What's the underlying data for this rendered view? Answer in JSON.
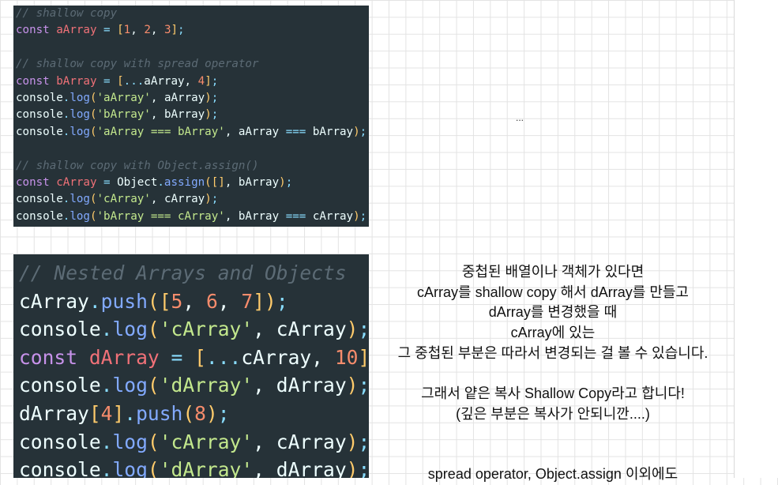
{
  "code_block_1": {
    "lines": [
      [
        [
          "c-comment",
          "// shallow copy"
        ]
      ],
      [
        [
          "c-kw",
          "const "
        ],
        [
          "c-var",
          "aArray"
        ],
        [
          "c-op",
          " = "
        ],
        [
          "c-br",
          "["
        ],
        [
          "c-num",
          "1"
        ],
        [
          "c-plain",
          ", "
        ],
        [
          "c-num",
          "2"
        ],
        [
          "c-plain",
          ", "
        ],
        [
          "c-num",
          "3"
        ],
        [
          "c-br",
          "]"
        ],
        [
          "c-op",
          ";"
        ]
      ],
      [],
      [
        [
          "c-comment",
          "// shallow copy with spread operator"
        ]
      ],
      [
        [
          "c-kw",
          "const "
        ],
        [
          "c-var",
          "bArray"
        ],
        [
          "c-op",
          " = "
        ],
        [
          "c-br",
          "["
        ],
        [
          "c-op",
          "..."
        ],
        [
          "c-plain",
          "aArray, "
        ],
        [
          "c-num",
          "4"
        ],
        [
          "c-br",
          "]"
        ],
        [
          "c-op",
          ";"
        ]
      ],
      [
        [
          "c-plain",
          "console"
        ],
        [
          "c-op",
          "."
        ],
        [
          "c-fn",
          "log"
        ],
        [
          "c-br",
          "("
        ],
        [
          "c-str",
          "'aArray'"
        ],
        [
          "c-plain",
          ", aArray"
        ],
        [
          "c-br",
          ")"
        ],
        [
          "c-op",
          ";"
        ]
      ],
      [
        [
          "c-plain",
          "console"
        ],
        [
          "c-op",
          "."
        ],
        [
          "c-fn",
          "log"
        ],
        [
          "c-br",
          "("
        ],
        [
          "c-str",
          "'bArray'"
        ],
        [
          "c-plain",
          ", bArray"
        ],
        [
          "c-br",
          ")"
        ],
        [
          "c-op",
          ";"
        ]
      ],
      [
        [
          "c-plain",
          "console"
        ],
        [
          "c-op",
          "."
        ],
        [
          "c-fn",
          "log"
        ],
        [
          "c-br",
          "("
        ],
        [
          "c-str",
          "'aArray === bArray'"
        ],
        [
          "c-plain",
          ", aArray "
        ],
        [
          "c-op",
          "==="
        ],
        [
          "c-plain",
          " bArray"
        ],
        [
          "c-br",
          ")"
        ],
        [
          "c-op",
          ";"
        ]
      ],
      [],
      [
        [
          "c-comment",
          "// shallow copy with Object.assign()"
        ]
      ],
      [
        [
          "c-kw",
          "const "
        ],
        [
          "c-var",
          "cArray"
        ],
        [
          "c-op",
          " = "
        ],
        [
          "c-plain",
          "Object"
        ],
        [
          "c-op",
          "."
        ],
        [
          "c-fn",
          "assign"
        ],
        [
          "c-br",
          "("
        ],
        [
          "c-br",
          "[]"
        ],
        [
          "c-plain",
          ", bArray"
        ],
        [
          "c-br",
          ")"
        ],
        [
          "c-op",
          ";"
        ]
      ],
      [
        [
          "c-plain",
          "console"
        ],
        [
          "c-op",
          "."
        ],
        [
          "c-fn",
          "log"
        ],
        [
          "c-br",
          "("
        ],
        [
          "c-str",
          "'cArray'"
        ],
        [
          "c-plain",
          ", cArray"
        ],
        [
          "c-br",
          ")"
        ],
        [
          "c-op",
          ";"
        ]
      ],
      [
        [
          "c-plain",
          "console"
        ],
        [
          "c-op",
          "."
        ],
        [
          "c-fn",
          "log"
        ],
        [
          "c-br",
          "("
        ],
        [
          "c-str",
          "'bArray === cArray'"
        ],
        [
          "c-plain",
          ", bArray "
        ],
        [
          "c-op",
          "==="
        ],
        [
          "c-plain",
          " cArray"
        ],
        [
          "c-br",
          ")"
        ],
        [
          "c-op",
          ";"
        ]
      ]
    ]
  },
  "code_block_2": {
    "lines": [
      [
        [
          "c-comment",
          "// Nested Arrays and Objects"
        ]
      ],
      [
        [
          "c-plain",
          "cArray"
        ],
        [
          "c-op",
          "."
        ],
        [
          "c-fn",
          "push"
        ],
        [
          "c-br",
          "("
        ],
        [
          "c-br",
          "["
        ],
        [
          "c-num",
          "5"
        ],
        [
          "c-plain",
          ", "
        ],
        [
          "c-num",
          "6"
        ],
        [
          "c-plain",
          ", "
        ],
        [
          "c-num",
          "7"
        ],
        [
          "c-br",
          "]"
        ],
        [
          "c-br",
          ")"
        ],
        [
          "c-op",
          ";"
        ]
      ],
      [
        [
          "c-plain",
          "console"
        ],
        [
          "c-op",
          "."
        ],
        [
          "c-fn",
          "log"
        ],
        [
          "c-br",
          "("
        ],
        [
          "c-str",
          "'cArray'"
        ],
        [
          "c-plain",
          ", cArray"
        ],
        [
          "c-br",
          ")"
        ],
        [
          "c-op",
          ";"
        ]
      ],
      [
        [
          "c-kw",
          "const "
        ],
        [
          "c-var",
          "dArray"
        ],
        [
          "c-op",
          " = "
        ],
        [
          "c-br",
          "["
        ],
        [
          "c-op",
          "..."
        ],
        [
          "c-plain",
          "cArray, "
        ],
        [
          "c-num",
          "10"
        ],
        [
          "c-br",
          "]"
        ],
        [
          "c-op",
          ";"
        ]
      ],
      [
        [
          "c-plain",
          "console"
        ],
        [
          "c-op",
          "."
        ],
        [
          "c-fn",
          "log"
        ],
        [
          "c-br",
          "("
        ],
        [
          "c-str",
          "'dArray'"
        ],
        [
          "c-plain",
          ", dArray"
        ],
        [
          "c-br",
          ")"
        ],
        [
          "c-op",
          ";"
        ]
      ],
      [
        [
          "c-plain",
          "dArray"
        ],
        [
          "c-br",
          "["
        ],
        [
          "c-num",
          "4"
        ],
        [
          "c-br",
          "]"
        ],
        [
          "c-op",
          "."
        ],
        [
          "c-fn",
          "push"
        ],
        [
          "c-br",
          "("
        ],
        [
          "c-num",
          "8"
        ],
        [
          "c-br",
          ")"
        ],
        [
          "c-op",
          ";"
        ]
      ],
      [
        [
          "c-plain",
          "console"
        ],
        [
          "c-op",
          "."
        ],
        [
          "c-fn",
          "log"
        ],
        [
          "c-br",
          "("
        ],
        [
          "c-str",
          "'cArray'"
        ],
        [
          "c-plain",
          ", cArray"
        ],
        [
          "c-br",
          ")"
        ],
        [
          "c-op",
          ";"
        ]
      ],
      [
        [
          "c-plain",
          "console"
        ],
        [
          "c-op",
          "."
        ],
        [
          "c-fn",
          "log"
        ],
        [
          "c-br",
          "("
        ],
        [
          "c-str",
          "'dArray'"
        ],
        [
          "c-plain",
          ", dArray"
        ],
        [
          "c-br",
          ")"
        ],
        [
          "c-op",
          ";"
        ]
      ]
    ]
  },
  "ellipsis_text": "...",
  "note_top": {
    "lines": [
      "중첩된 배열이나 객체가 있다면",
      "cArray를 shallow copy 해서 dArray를 만들고",
      "dArray를 변경했을 때",
      "cArray에 있는",
      "그 중첩된 부분은 따라서 변경되는 걸 볼 수 있습니다.",
      "",
      "그래서 얕은 복사 Shallow Copy라고 합니다!",
      "(깊은 부분은 복사가 안되니깐....)"
    ]
  },
  "note_bottom": {
    "lines": [
      "spread operator, Object.assign 이외에도"
    ]
  }
}
